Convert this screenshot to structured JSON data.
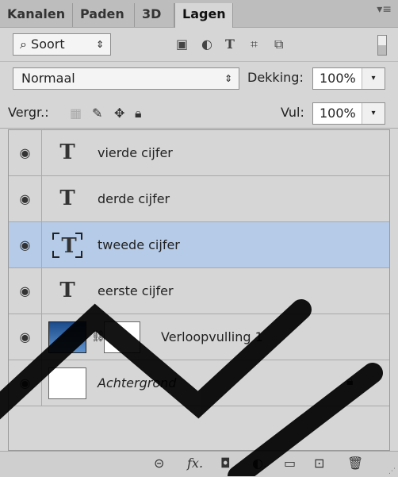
{
  "tabs": [
    "Kanalen",
    "Paden",
    "3D",
    "Lagen"
  ],
  "filter": {
    "kind_label": "Soort"
  },
  "blend": {
    "mode": "Normaal",
    "opacity_label": "Dekking:",
    "opacity_value": "100%"
  },
  "lock": {
    "label": "Vergr.:",
    "fill_label": "Vul:",
    "fill_value": "100%"
  },
  "layers": [
    {
      "name": "vierde cijfer"
    },
    {
      "name": "derde cijfer"
    },
    {
      "name": "tweede cijfer"
    },
    {
      "name": "eerste cijfer"
    },
    {
      "name": "Verloopvulling 1"
    },
    {
      "name": "Achtergrond"
    }
  ],
  "colors": {
    "selected_row": "#b5cbe8",
    "panel_bg": "#d6d6d6"
  }
}
